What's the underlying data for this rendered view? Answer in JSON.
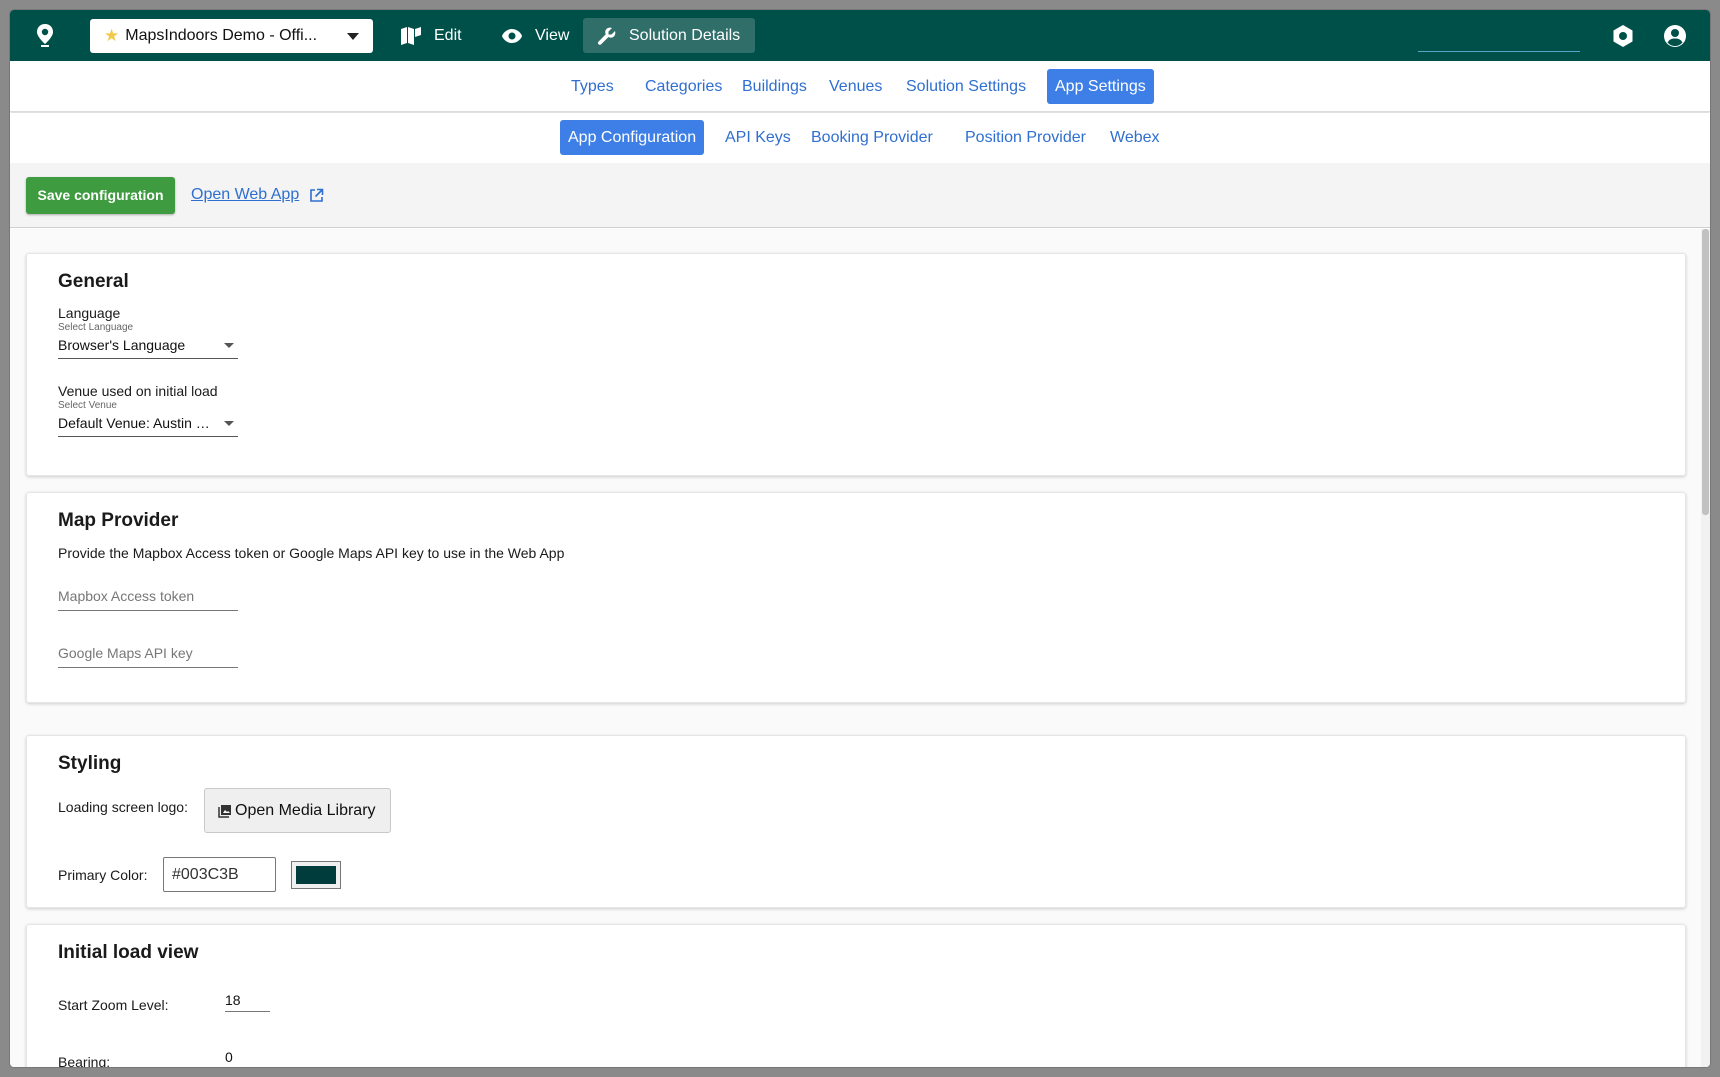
{
  "topbar": {
    "solution_name": "MapsIndoors Demo - Offi...",
    "nav": [
      {
        "label": "Edit",
        "icon": "map-icon"
      },
      {
        "label": "View",
        "icon": "eye-icon"
      },
      {
        "label": "Solution Details",
        "icon": "wrench-icon",
        "active": true
      }
    ],
    "brand_color": "#00504A"
  },
  "primary_tabs": [
    "Types",
    "Categories",
    "Buildings",
    "Venues",
    "Solution Settings",
    "App Settings"
  ],
  "primary_active": "App Settings",
  "secondary_tabs": [
    "App Configuration",
    "API Keys",
    "Booking Provider",
    "Position Provider",
    "Webex"
  ],
  "secondary_active": "App Configuration",
  "actions": {
    "save_label": "Save configuration",
    "open_web_app_label": "Open Web App"
  },
  "general": {
    "title": "General",
    "language_label": "Language",
    "language_sublabel": "Select Language",
    "language_value": "Browser's Language",
    "venue_label": "Venue used on initial load",
    "venue_sublabel": "Select Venue",
    "venue_value": "Default Venue: Austin Office"
  },
  "map_provider": {
    "title": "Map Provider",
    "description": "Provide the Mapbox Access token or Google Maps API key to use in the Web App",
    "mapbox_placeholder": "Mapbox Access token",
    "google_placeholder": "Google Maps API key"
  },
  "styling": {
    "title": "Styling",
    "logo_label": "Loading screen logo:",
    "media_button_label": "Open Media Library",
    "primary_color_label": "Primary Color:",
    "primary_color_value": "#003C3B"
  },
  "initial_load_view": {
    "title": "Initial load view",
    "zoom_label": "Start Zoom Level:",
    "zoom_value": "18",
    "bearing_label": "Bearing:",
    "bearing_value": "0"
  }
}
